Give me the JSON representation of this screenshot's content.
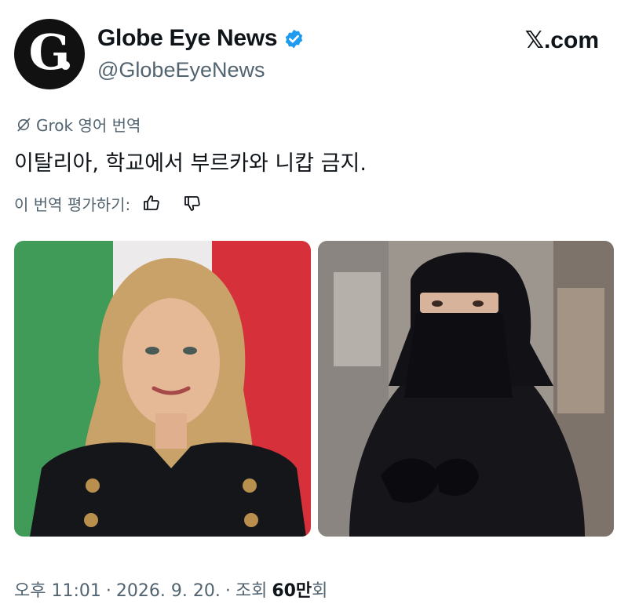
{
  "author": {
    "avatar_text": "G",
    "display_name": "Globe Eye News",
    "handle": "@GlobeEyeNews",
    "verified": true
  },
  "brand": {
    "x_symbol": "𝕏",
    "site_label": ".com"
  },
  "translation": {
    "header": "Grok 영어 번역",
    "text": "이탈리아, 학교에서 부르카와 니캅 금지.",
    "rate_label": "이 번역 평가하기:"
  },
  "media": [
    {
      "icon": "photo-woman-italian-flag"
    },
    {
      "icon": "photo-woman-niqab"
    }
  ],
  "meta": {
    "time": "오후 11:01",
    "date": "2026. 9. 20.",
    "separator": "·",
    "views_label": "조회",
    "views_count": "60만",
    "views_suffix": "회"
  },
  "colors": {
    "verified": "#1d9bf0",
    "secondary_text": "#536471",
    "primary_text": "#0f1419"
  }
}
